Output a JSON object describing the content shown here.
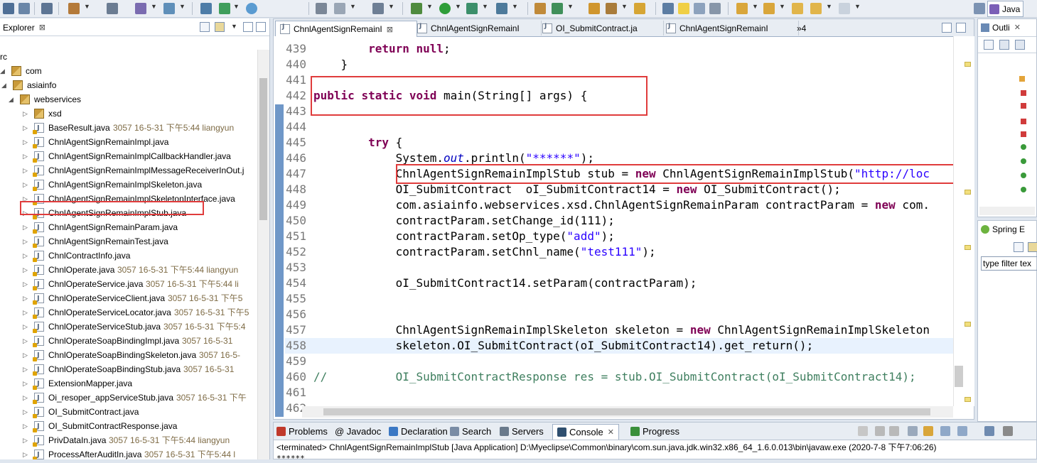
{
  "toolbar": {
    "perspective_label": "Java"
  },
  "explorer": {
    "title": "Explorer",
    "close": "⊠",
    "tree": [
      {
        "label": "rc",
        "meta": "",
        "kind": "text",
        "depth": 0
      },
      {
        "label": "com",
        "meta": "",
        "kind": "pkg",
        "depth": 0
      },
      {
        "label": "asiainfo",
        "meta": "",
        "kind": "pkg",
        "depth": 1
      },
      {
        "label": "webservices",
        "meta": "",
        "kind": "pkg",
        "depth": 2
      },
      {
        "label": "xsd",
        "meta": "",
        "kind": "pkg",
        "depth": 3
      },
      {
        "label": "BaseResult.java",
        "meta": "3057  16-5-31 下午5:44  liangyun",
        "kind": "java",
        "depth": 3
      },
      {
        "label": "ChnlAgentSignRemainImpl.java",
        "meta": "",
        "kind": "java",
        "depth": 3
      },
      {
        "label": "ChnlAgentSignRemainImplCallbackHandler.java",
        "meta": "",
        "kind": "java",
        "depth": 3
      },
      {
        "label": "ChnlAgentSignRemainImplMessageReceiverInOut.j",
        "meta": "",
        "kind": "java",
        "depth": 3
      },
      {
        "label": "ChnlAgentSignRemainImplSkeleton.java",
        "meta": "",
        "kind": "java",
        "depth": 3
      },
      {
        "label": "ChnlAgentSignRemainImplSkeletonInterface.java",
        "meta": "",
        "kind": "java",
        "depth": 3
      },
      {
        "label": "ChnlAgentSignRemainImplStub.java",
        "meta": "",
        "kind": "java",
        "depth": 3,
        "highlight": true
      },
      {
        "label": "ChnlAgentSignRemainParam.java",
        "meta": "",
        "kind": "java",
        "depth": 3
      },
      {
        "label": "ChnlAgentSignRemainTest.java",
        "meta": "",
        "kind": "java",
        "depth": 3
      },
      {
        "label": "ChnlContractInfo.java",
        "meta": "",
        "kind": "java",
        "depth": 3
      },
      {
        "label": "ChnlOperate.java",
        "meta": "3057  16-5-31 下午5:44  liangyun",
        "kind": "java",
        "depth": 3
      },
      {
        "label": "ChnlOperateService.java",
        "meta": "3057  16-5-31 下午5:44  li",
        "kind": "java",
        "depth": 3
      },
      {
        "label": "ChnlOperateServiceClient.java",
        "meta": "3057  16-5-31 下午5",
        "kind": "java",
        "depth": 3
      },
      {
        "label": "ChnlOperateServiceLocator.java",
        "meta": "3057  16-5-31 下午5",
        "kind": "java",
        "depth": 3
      },
      {
        "label": "ChnlOperateServiceStub.java",
        "meta": "3057  16-5-31 下午5:4",
        "kind": "java",
        "depth": 3
      },
      {
        "label": "ChnlOperateSoapBindingImpl.java",
        "meta": "3057  16-5-31  ",
        "kind": "java",
        "depth": 3
      },
      {
        "label": "ChnlOperateSoapBindingSkeleton.java",
        "meta": "3057  16-5-",
        "kind": "java",
        "depth": 3
      },
      {
        "label": "ChnlOperateSoapBindingStub.java",
        "meta": "3057  16-5-31  ",
        "kind": "java",
        "depth": 3
      },
      {
        "label": "ExtensionMapper.java",
        "meta": "",
        "kind": "java",
        "depth": 3
      },
      {
        "label": "Oi_resoper_appServiceStub.java",
        "meta": "3057  16-5-31 下午",
        "kind": "java",
        "depth": 3
      },
      {
        "label": "OI_SubmitContract.java",
        "meta": "",
        "kind": "java",
        "depth": 3
      },
      {
        "label": "OI_SubmitContractResponse.java",
        "meta": "",
        "kind": "java",
        "depth": 3
      },
      {
        "label": "PrivDataIn.java",
        "meta": "3057  16-5-31 下午5:44  liangyun",
        "kind": "java",
        "depth": 3
      },
      {
        "label": "ProcessAfterAuditIn.java",
        "meta": "3057  16-5-31 下午5:44  l",
        "kind": "java",
        "depth": 3
      },
      {
        "label": "ProcessAfterAuditOut.java",
        "meta": "3057  16-5-31 下午5:44",
        "kind": "java",
        "depth": 3
      }
    ]
  },
  "editor": {
    "tabs": [
      {
        "label": "ChnlAgentSignRemainI",
        "active": true,
        "close": "⊠"
      },
      {
        "label": "ChnlAgentSignRemainI",
        "active": false
      },
      {
        "label": "OI_SubmitContract.ja",
        "active": false
      },
      {
        "label": "ChnlAgentSignRemainI",
        "active": false
      }
    ],
    "overflow": "»4",
    "lines": [
      {
        "n": "439",
        "segs": [
          {
            "t": "        "
          },
          {
            "t": "return",
            "c": "kw"
          },
          {
            "t": " "
          },
          {
            "t": "null",
            "c": "kw"
          },
          {
            "t": ";"
          }
        ]
      },
      {
        "n": "440",
        "segs": [
          {
            "t": "    }"
          }
        ]
      },
      {
        "n": "441",
        "segs": []
      },
      {
        "n": "442",
        "segs": [
          {
            "t": "public",
            "c": "kw"
          },
          {
            "t": " "
          },
          {
            "t": "static",
            "c": "kw"
          },
          {
            "t": " "
          },
          {
            "t": "void",
            "c": "kw"
          },
          {
            "t": " main(String[] args) {"
          }
        ]
      },
      {
        "n": "443",
        "segs": []
      },
      {
        "n": "444",
        "segs": []
      },
      {
        "n": "445",
        "segs": [
          {
            "t": "        "
          },
          {
            "t": "try",
            "c": "kw"
          },
          {
            "t": " {"
          }
        ]
      },
      {
        "n": "446",
        "segs": [
          {
            "t": "            System."
          },
          {
            "t": "out",
            "c": "fld"
          },
          {
            "t": ".println("
          },
          {
            "t": "\"******\"",
            "c": "str"
          },
          {
            "t": ");"
          }
        ]
      },
      {
        "n": "447",
        "segs": [
          {
            "t": "            ChnlAgentSignRemainImplStub stub = "
          },
          {
            "t": "new",
            "c": "kw"
          },
          {
            "t": " ChnlAgentSignRemainImplStub("
          },
          {
            "t": "\"http://loc",
            "c": "str"
          }
        ]
      },
      {
        "n": "448",
        "segs": [
          {
            "t": "            OI_SubmitContract  oI_SubmitContract14 = "
          },
          {
            "t": "new",
            "c": "kw"
          },
          {
            "t": " OI_SubmitContract();"
          }
        ]
      },
      {
        "n": "449",
        "segs": [
          {
            "t": "            com.asiainfo.webservices.xsd.ChnlAgentSignRemainParam contractParam = "
          },
          {
            "t": "new",
            "c": "kw"
          },
          {
            "t": " com."
          }
        ]
      },
      {
        "n": "450",
        "segs": [
          {
            "t": "            contractParam.setChange_id(111);"
          }
        ]
      },
      {
        "n": "451",
        "segs": [
          {
            "t": "            contractParam.setOp_type("
          },
          {
            "t": "\"add\"",
            "c": "str"
          },
          {
            "t": ");"
          }
        ]
      },
      {
        "n": "452",
        "segs": [
          {
            "t": "            contractParam.setChnl_name("
          },
          {
            "t": "\"test111\"",
            "c": "str"
          },
          {
            "t": ");"
          }
        ]
      },
      {
        "n": "453",
        "segs": []
      },
      {
        "n": "454",
        "segs": [
          {
            "t": "            oI_SubmitContract14.setParam(contractParam);"
          }
        ]
      },
      {
        "n": "455",
        "segs": []
      },
      {
        "n": "456",
        "segs": []
      },
      {
        "n": "457",
        "segs": [
          {
            "t": "            ChnlAgentSignRemainImplSkeleton skeleton = "
          },
          {
            "t": "new",
            "c": "kw"
          },
          {
            "t": " ChnlAgentSignRemainImplSkeleton"
          }
        ]
      },
      {
        "n": "458",
        "segs": [
          {
            "t": "            skeleton.OI_SubmitContract(oI_SubmitContract14).get_return();"
          }
        ],
        "current": true
      },
      {
        "n": "459",
        "segs": []
      },
      {
        "n": "460",
        "segs": [
          {
            "t": "//          OI_SubmitContractResponse res = stub.OI_SubmitContract(oI_SubmitContract14);",
            "c": "cmt"
          }
        ]
      },
      {
        "n": "461",
        "segs": []
      },
      {
        "n": "462",
        "segs": []
      }
    ]
  },
  "console": {
    "tabs": [
      {
        "label": "Problems",
        "icon_color": "#c0392b"
      },
      {
        "label": "@ Javadoc",
        "icon_color": ""
      },
      {
        "label": "Declaration",
        "icon_color": "#3b78c4"
      },
      {
        "label": "Search",
        "icon_color": "#7a8ca5"
      },
      {
        "label": "Servers",
        "icon_color": "#6a7a8c"
      },
      {
        "label": "Console",
        "icon_color": "#2f4f6f",
        "active": true
      },
      {
        "label": "Progress",
        "icon_color": "#3a8f3a"
      }
    ],
    "status": "<terminated> ChnlAgentSignRemainImplStub [Java Application] D:\\Myeclipse\\Common\\binary\\com.sun.java.jdk.win32.x86_64_1.6.0.013\\bin\\javaw.exe (2020-7-8 下午7:06:26)",
    "output": "******"
  },
  "outline": {
    "title": "Outli"
  },
  "spring": {
    "title": "Spring E",
    "filter_placeholder": "type filter tex"
  },
  "colors": {
    "keyword": "#7f0055",
    "string": "#2a00ff",
    "comment": "#3f7f5f",
    "highlight_box": "#e03c3c"
  }
}
